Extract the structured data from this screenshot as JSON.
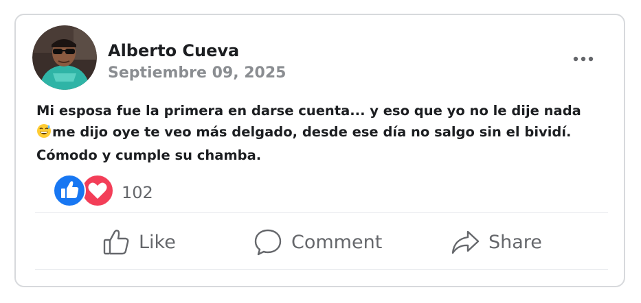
{
  "post": {
    "author": "Alberto Cueva",
    "date": "Septiembre 09, 2025",
    "text_line1": "Mi esposa fue la primera en darse cuenta... y eso que yo no le dije nada",
    "text_line2_emoji": "😅",
    "text_line2": "me dijo oye te veo más delgado, desde ese día no salgo sin el bividí.",
    "text_line3": "Cómodo y cumple su chamba."
  },
  "reactions": {
    "count": "102",
    "types": [
      "like-icon",
      "heart-icon"
    ]
  },
  "actions": {
    "like_label": "Like",
    "comment_label": "Comment",
    "share_label": "Share"
  },
  "colors": {
    "like_blue": "#1877f2",
    "love_red": "#f33e58",
    "muted_gray": "#65676b",
    "date_gray": "#8a8d91"
  }
}
